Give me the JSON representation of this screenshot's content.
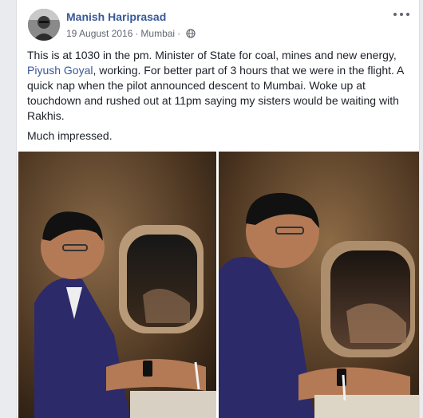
{
  "post": {
    "author": "Manish Hariprasad",
    "date": "19 August 2016",
    "separator": "·",
    "location": "Mumbai",
    "location_separator": "·",
    "para1_before_link": "This is at 1030 in the pm. Minister of State for coal, mines and new energy, ",
    "mention": "Piyush Goyal",
    "para1_after_link": ", working. For better part of 3 hours that we were in the flight. A quick nap when the pilot announced descent to Mumbai. Woke up at touchdown and rushed out at 11pm saying my sisters would be waiting with Rakhis.",
    "para2": "Much impressed."
  },
  "icons": {
    "globe": "globe-icon",
    "more": "more-options-icon"
  },
  "colors": {
    "link": "#385898",
    "text": "#1d2129",
    "meta": "#616770",
    "background": "#e9ebee"
  }
}
